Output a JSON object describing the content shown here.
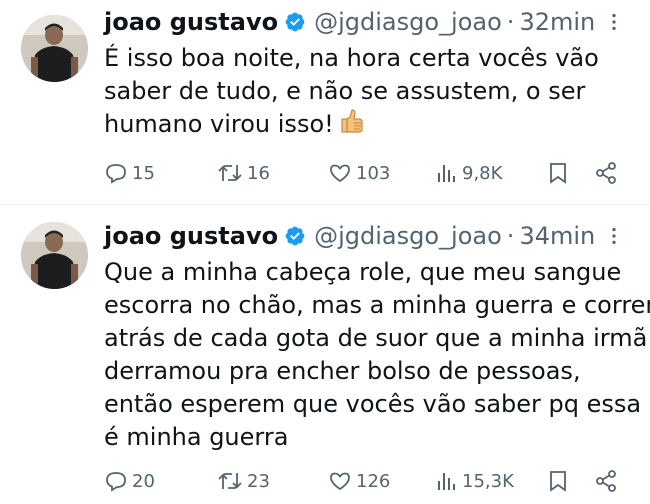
{
  "tweets": [
    {
      "name": "joao gustavo",
      "handle": "@jgdiasgo_joao",
      "separator": "·",
      "time": "32min",
      "lines": [
        "É isso boa noite, na hora certa vocês vão",
        "saber de tudo, e não se assustem, o ser",
        "humano virou isso!"
      ],
      "emoji": "thumbs-up",
      "replies": "15",
      "retweets": "16",
      "likes": "103",
      "views": "9,8K"
    },
    {
      "name": "joao gustavo",
      "handle": "@jgdiasgo_joao",
      "separator": "·",
      "time": "34min",
      "lines": [
        "Que a minha cabeça role, que meu sangue",
        "escorra no chão, mas a minha guerra e correr",
        "atrás de cada gota de suor que a minha irmã",
        "derramou pra encher bolso de pessoas,",
        "então esperem que vocês vão saber pq essa",
        "é minha guerra"
      ],
      "replies": "20",
      "retweets": "23",
      "likes": "126",
      "views": "15,3K"
    }
  ],
  "colors": {
    "text": "#0f1419",
    "secondary": "#536471",
    "verified": "#1d9bf0",
    "divider": "#eff3f4"
  },
  "icons": [
    "verified-badge-icon",
    "more-icon",
    "reply-icon",
    "retweet-icon",
    "like-icon",
    "views-icon",
    "bookmark-icon",
    "share-icon",
    "thumbs-up-emoji"
  ]
}
